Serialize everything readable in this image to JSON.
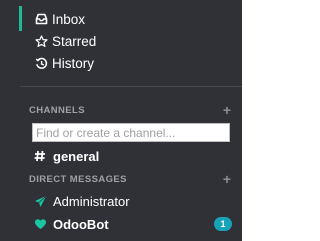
{
  "nav": {
    "inbox": {
      "label": "Inbox",
      "icon": "inbox-icon"
    },
    "starred": {
      "label": "Starred",
      "icon": "star-icon"
    },
    "history": {
      "label": "History",
      "icon": "history-icon"
    }
  },
  "channels": {
    "header": "CHANNELS",
    "add_icon": "plus-icon",
    "search_placeholder": "Find or create a channel...",
    "items": [
      {
        "label": "general",
        "icon": "hash-icon"
      }
    ]
  },
  "direct_messages": {
    "header": "DIRECT MESSAGES",
    "add_icon": "plus-icon",
    "items": [
      {
        "label": "Administrator",
        "icon": "paper-plane-icon"
      },
      {
        "label": "OdooBot",
        "icon": "heart-icon",
        "unread": "1"
      }
    ]
  },
  "colors": {
    "sidebar_bg": "#2f3136",
    "active_accent": "#21b799",
    "badge_bg": "#17a2b8",
    "heart": "#1ac6a0"
  }
}
